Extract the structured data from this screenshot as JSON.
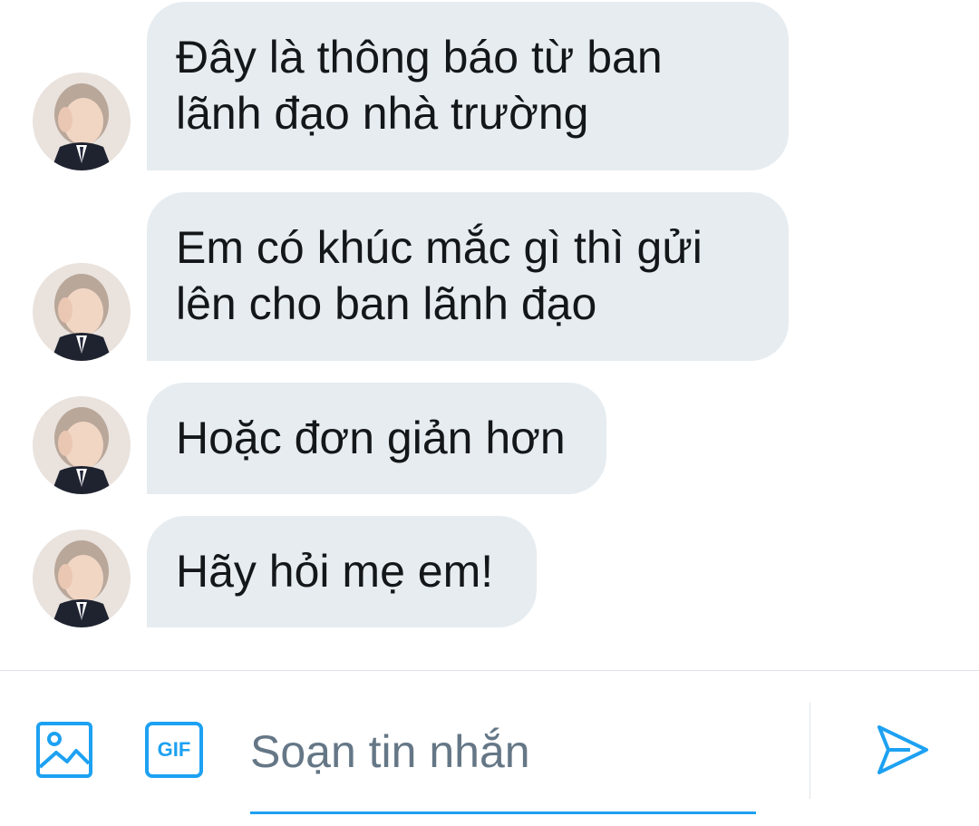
{
  "conversation": {
    "messages": [
      {
        "text": "Đây là thông báo từ ban\nlãnh đạo nhà trường"
      },
      {
        "text": "Em có khúc mắc gì thì gửi\nlên cho ban lãnh đạo"
      },
      {
        "text": "Hoặc đơn giản hơn"
      },
      {
        "text": "Hãy hỏi mẹ em!"
      }
    ]
  },
  "composer": {
    "placeholder": "Soạn tin nhắn",
    "value": "",
    "gif_label": "GIF",
    "image_icon": "image-icon",
    "send_icon": "send-icon"
  },
  "colors": {
    "accent": "#1da1f2",
    "bubble": "#e6ecf0",
    "text": "#14171a",
    "placeholder": "#657786"
  }
}
